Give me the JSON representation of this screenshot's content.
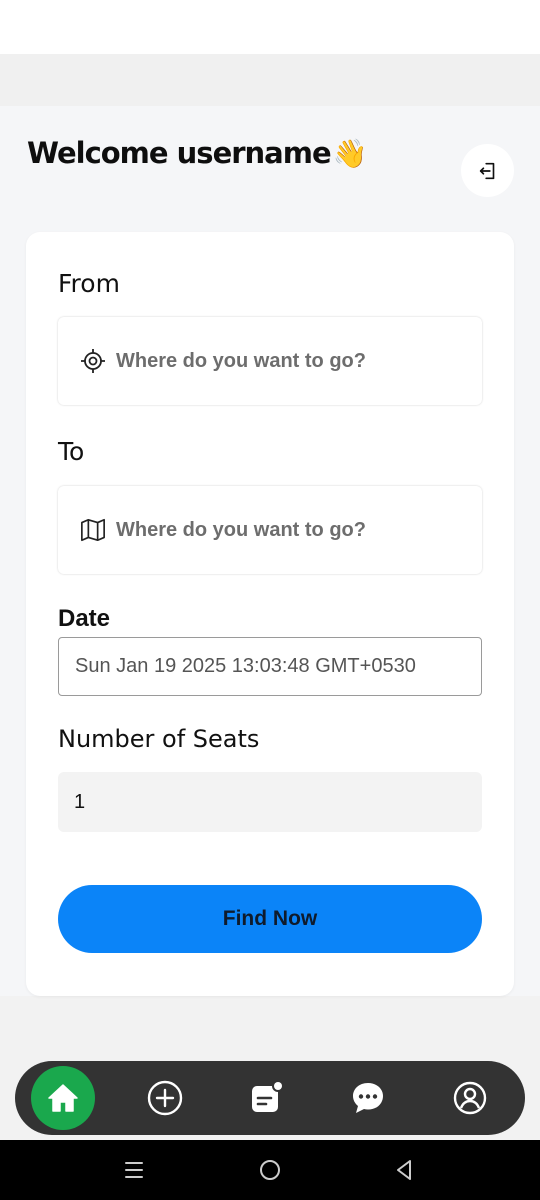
{
  "header": {
    "welcome_text": "Welcome username",
    "wave_emoji": "👋",
    "logout_icon": "logout-icon"
  },
  "form": {
    "from_label": "From",
    "from_placeholder": "Where do you want to go?",
    "from_icon": "crosshair-icon",
    "to_label": "To",
    "to_placeholder": "Where do you want to go?",
    "to_icon": "map-icon",
    "date_label": "Date",
    "date_value": "Sun Jan 19 2025 13:03:48 GMT+0530",
    "seats_label": "Number of Seats",
    "seats_value": "1",
    "submit_label": "Find Now"
  },
  "bottom_nav": {
    "items": [
      {
        "icon": "home-icon",
        "active": true
      },
      {
        "icon": "add-circle-icon",
        "active": false
      },
      {
        "icon": "notes-icon",
        "active": false
      },
      {
        "icon": "chat-icon",
        "active": false
      },
      {
        "icon": "profile-icon",
        "active": false
      }
    ]
  },
  "colors": {
    "accent": "#0b84f8",
    "nav_active": "#1aa84d",
    "nav_bg": "#333333"
  }
}
